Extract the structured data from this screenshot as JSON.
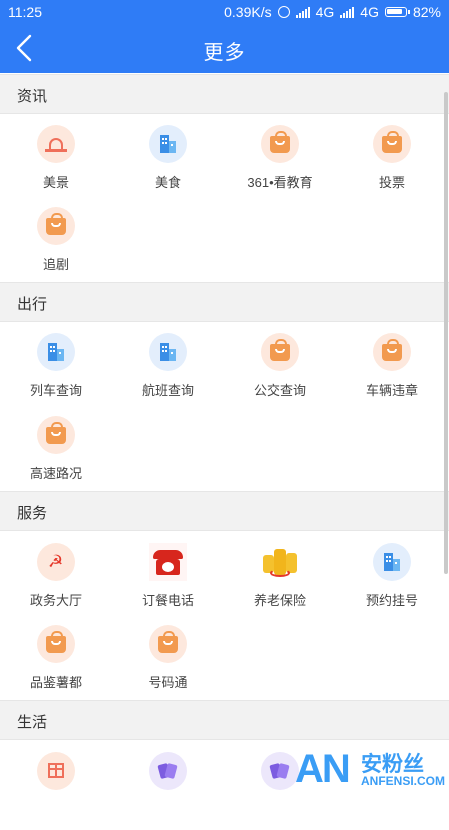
{
  "status_bar": {
    "time": "11:25",
    "net_speed": "0.39K/s",
    "sim1_label": "4G",
    "sim2_label": "4G",
    "battery": "82%"
  },
  "header": {
    "title": "更多"
  },
  "sections": [
    {
      "title": "资讯",
      "items": [
        {
          "label": "美景",
          "icon": "scenery-icon"
        },
        {
          "label": "美食",
          "icon": "building-icon"
        },
        {
          "label": "361•看教育",
          "icon": "bag-icon"
        },
        {
          "label": "投票",
          "icon": "bag-icon"
        },
        {
          "label": "追剧",
          "icon": "bag-icon"
        }
      ]
    },
    {
      "title": "出行",
      "items": [
        {
          "label": "列车查询",
          "icon": "building-icon"
        },
        {
          "label": "航班查询",
          "icon": "building-icon"
        },
        {
          "label": "公交查询",
          "icon": "bag-icon"
        },
        {
          "label": "车辆违章",
          "icon": "bag-icon"
        },
        {
          "label": "高速路况",
          "icon": "bag-icon"
        }
      ]
    },
    {
      "title": "服务",
      "items": [
        {
          "label": "政务大厅",
          "icon": "hammer-sickle-icon"
        },
        {
          "label": "订餐电话",
          "icon": "telephone-icon"
        },
        {
          "label": "养老保险",
          "icon": "coins-icon"
        },
        {
          "label": "预约挂号",
          "icon": "building-icon"
        },
        {
          "label": "品鉴薯都",
          "icon": "bag-icon"
        },
        {
          "label": "号码通",
          "icon": "bag-icon"
        }
      ]
    },
    {
      "title": "生活",
      "items": [
        {
          "icon": "gift-icon"
        },
        {
          "icon": "cards-icon"
        },
        {
          "icon": "cards-icon"
        },
        {
          "icon": "building-icon"
        }
      ]
    }
  ],
  "watermark": {
    "logo": "AN",
    "cn": "安粉丝",
    "en": "ANFENSI.COM"
  },
  "colors": {
    "header_bg": "#2f7cf6",
    "section_bg": "#f2f2f2",
    "icon_orange": "#f29a4f",
    "icon_blue": "#3a8ee6"
  }
}
